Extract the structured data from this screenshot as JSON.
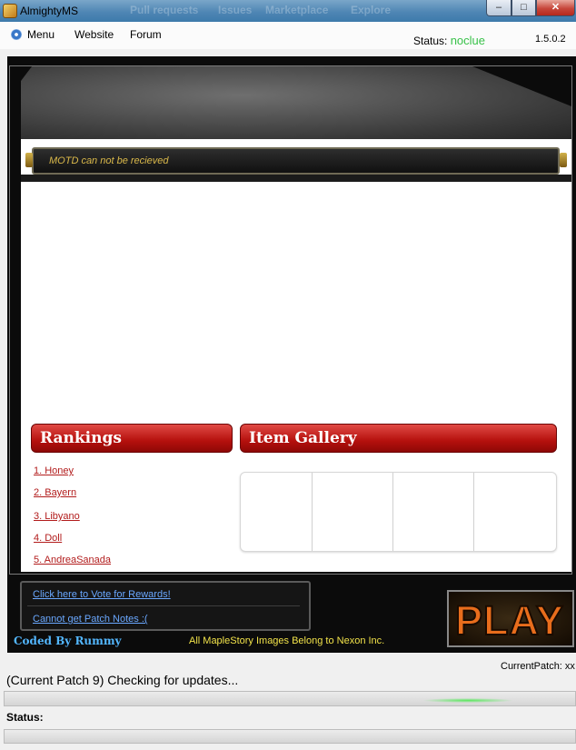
{
  "window": {
    "title": "AlmightyMS",
    "ghost_tabs": [
      "Pull requests",
      "Issues",
      "Marketplace",
      "Explore"
    ]
  },
  "menubar": {
    "items": [
      "Menu",
      "Website",
      "Forum"
    ],
    "status_label": "Status:",
    "status_value": "noclue",
    "version": "1.5.0.2"
  },
  "motd": {
    "text": "MOTD can not be recieved"
  },
  "rankings": {
    "title": "Rankings",
    "entries": [
      "1. Honey",
      "2. Bayern",
      "3. Libyano",
      "4. Doll",
      "5. AndreaSanada"
    ]
  },
  "gallery": {
    "title": "Item Gallery"
  },
  "links": {
    "vote": "Click here to Vote for Rewards!",
    "patch_notes": "Cannot get Patch Notes :("
  },
  "play_label": "PLAY",
  "credit": "Coded By Rummy",
  "disclaimer": "All MapleStory Images Belong to Nexon Inc.",
  "footer": {
    "current_patch": "CurrentPatch: xx",
    "update_text": "(Current Patch 9) Checking for updates...",
    "status_label": "Status:"
  },
  "colors": {
    "status_green": "#39c24a",
    "panel_red": "#b5100d",
    "play_orange": "#e86d1c"
  }
}
